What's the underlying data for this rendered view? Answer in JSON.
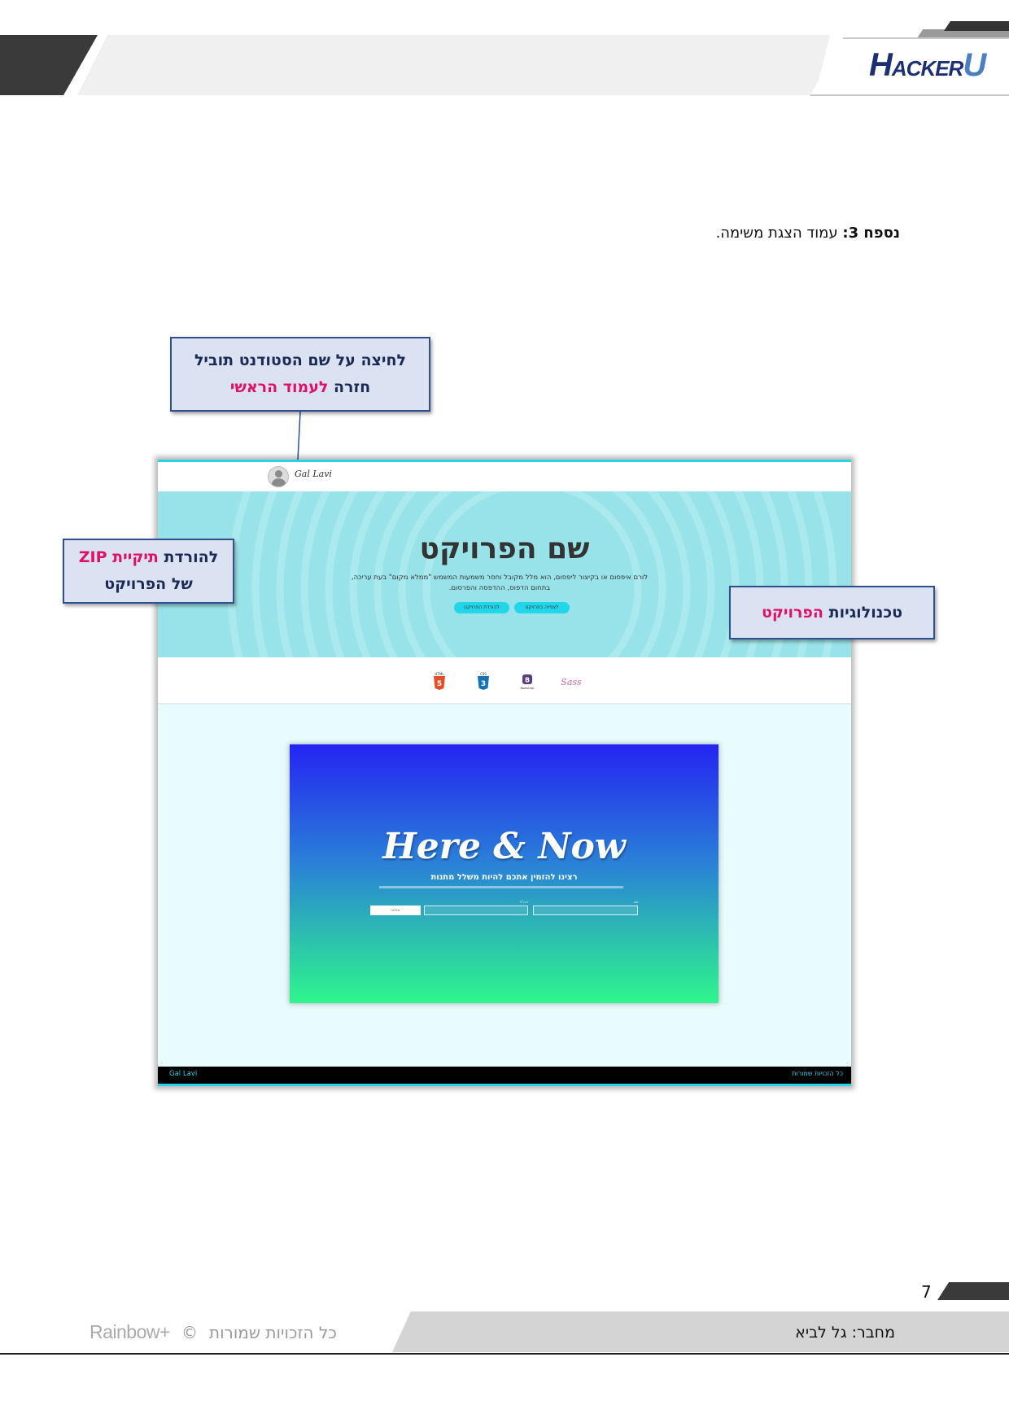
{
  "header": {
    "logo_h": "H",
    "logo_acker": "ACKER",
    "logo_u": "U"
  },
  "intro": {
    "label": "נספח 3",
    "text": "עמוד הצגת משימה."
  },
  "callouts": {
    "student_name": {
      "line1": "לחיצה על שם הסטודנט תוביל",
      "line2_prefix": "חזרה ",
      "line2_highlight": "לעמוד הראשי"
    },
    "zip_download": {
      "line1_prefix": "להורדת ",
      "line1_highlight": "תיקיית ZIP",
      "line2": "של הפרויקט"
    },
    "technologies": {
      "prefix": "טכנולוגיות ",
      "highlight": "הפרויקט"
    }
  },
  "screenshot": {
    "student_name": "Gal Lavi",
    "project_title": "שם הפרויקט",
    "project_description": "לורם איפסום או בקיצור ליפסום, הוא מלל מקובל וחסר משמעות המשמש \"ממלא מקום\" בעת עריכה, בתחום הדפוס, ההדפסה והפרסום.",
    "download_button": "להורדת הפרויקט",
    "view_button": "לצפייה בפרויקט",
    "technologies": [
      "HTML5",
      "CSS3",
      "Bootstrap",
      "Sass"
    ],
    "preview": {
      "title": "Here & Now",
      "subtitle": "רצינו להזמין אתכם להיות משלל מתנות",
      "label_1": "דוא\"ל",
      "label_2": "שם",
      "button": "שליחה"
    },
    "footer_left": "Gal Lavi",
    "footer_right": "כל הזכויות שמורות"
  },
  "footer": {
    "page_number": "7",
    "author": "מחבר: גל לביא",
    "rights": "כל הזכויות שמורות",
    "copyright_symbol": "©",
    "brand": "Rainbow+"
  },
  "colors": {
    "callout_bg": "#dbe2f2",
    "callout_border": "#2f4f8f",
    "highlight": "#e0106a",
    "hero_bg": "#98e3e9",
    "accent_cyan": "#26d3e8"
  }
}
